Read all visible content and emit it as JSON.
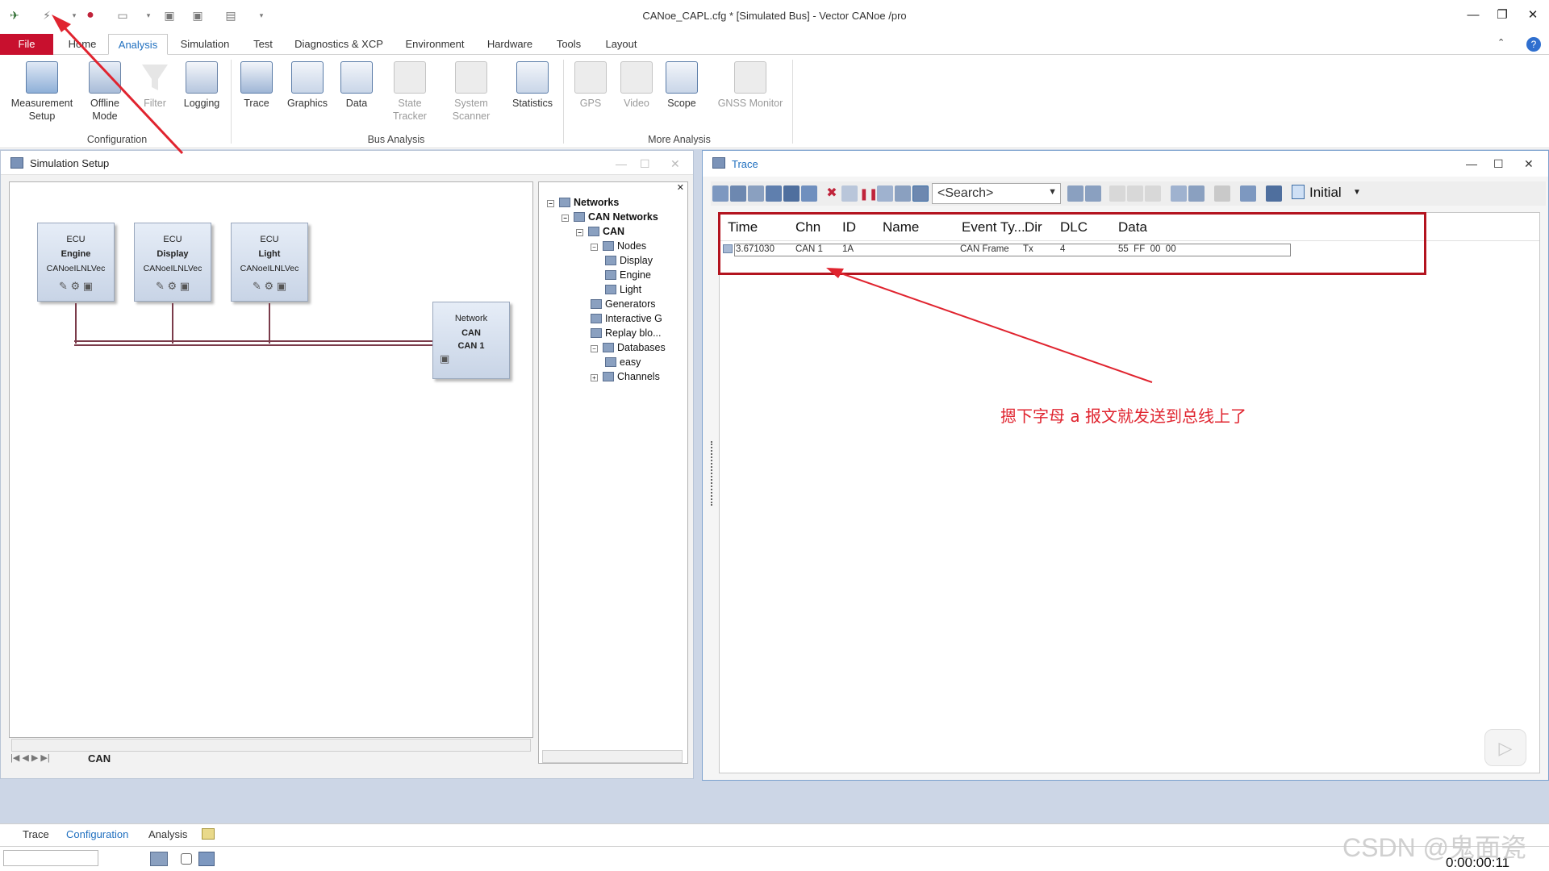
{
  "title": "CANoe_CAPL.cfg * [Simulated Bus] - Vector CANoe /pro",
  "qat": [
    "app-icon",
    "start-icon",
    "stop-icon",
    "open-icon",
    "save-icon",
    "save-as-icon",
    "pack-icon"
  ],
  "window_controls": {
    "minimize": "—",
    "restore": "❐",
    "close": "✕"
  },
  "ribbon": {
    "tabs": [
      "File",
      "Home",
      "Analysis",
      "Simulation",
      "Test",
      "Diagnostics & XCP",
      "Environment",
      "Hardware",
      "Tools",
      "Layout"
    ],
    "active_tab": "Analysis",
    "buttons": {
      "measurement_setup": "Measurement\nSetup",
      "offline_mode": "Offline\nMode",
      "filter": "Filter",
      "logging": "Logging",
      "trace": "Trace",
      "graphics": "Graphics",
      "data": "Data",
      "state_tracker": "State\nTracker",
      "system_scanner": "System\nScanner",
      "statistics": "Statistics",
      "gps": "GPS",
      "video": "Video",
      "scope": "Scope",
      "gnss_monitor": "GNSS Monitor"
    },
    "groups": {
      "configuration": "Configuration",
      "bus_analysis": "Bus Analysis",
      "more_analysis": "More Analysis"
    }
  },
  "sim_setup": {
    "title": "Simulation Setup",
    "ecus": [
      {
        "type": "ECU",
        "name": "Engine",
        "lib": "CANoeILNLVec"
      },
      {
        "type": "ECU",
        "name": "Display",
        "lib": "CANoeILNLVec"
      },
      {
        "type": "ECU",
        "name": "Light",
        "lib": "CANoeILNLVec"
      }
    ],
    "network": {
      "type": "Network",
      "name": "CAN",
      "channel": "CAN 1"
    },
    "bus_tab": "CAN",
    "tree": [
      {
        "label": "Networks",
        "bold": true,
        "level": 0
      },
      {
        "label": "CAN Networks",
        "bold": true,
        "level": 1
      },
      {
        "label": "CAN",
        "bold": true,
        "level": 2
      },
      {
        "label": "Nodes",
        "bold": false,
        "level": 3
      },
      {
        "label": "Display",
        "bold": false,
        "level": 4
      },
      {
        "label": "Engine",
        "bold": false,
        "level": 4
      },
      {
        "label": "Light",
        "bold": false,
        "level": 4
      },
      {
        "label": "Generators",
        "bold": false,
        "level": 3
      },
      {
        "label": "Interactive G",
        "bold": false,
        "level": 3
      },
      {
        "label": "Replay blo...",
        "bold": false,
        "level": 3
      },
      {
        "label": "Databases",
        "bold": false,
        "level": 3
      },
      {
        "label": "easy",
        "bold": false,
        "level": 4
      },
      {
        "label": "Channels",
        "bold": false,
        "level": 3
      }
    ]
  },
  "trace": {
    "title": "Trace",
    "search_placeholder": "<Search>",
    "layout_selector": "Initial",
    "columns": [
      "Time",
      "Chn",
      "ID",
      "Name",
      "Event Ty...",
      "Dir",
      "DLC",
      "Data"
    ],
    "rows": [
      {
        "time": "3.671030",
        "chn": "CAN 1",
        "id": "1A",
        "name": "",
        "event_type": "CAN Frame",
        "dir": "Tx",
        "dlc": "4",
        "data": "55  FF  00  00"
      }
    ]
  },
  "annotation": "摁下字母 a 报文就发送到总线上了",
  "bottom_tabs": [
    "Trace",
    "Configuration",
    "Analysis"
  ],
  "status": {
    "clock": "0:00:00:11"
  },
  "watermark": "CSDN @鬼面瓷",
  "colors": {
    "file_tab": "#c8102e",
    "accent": "#1f6fbf",
    "annotation": "#e0242f",
    "highlight_box": "#b3141f"
  }
}
